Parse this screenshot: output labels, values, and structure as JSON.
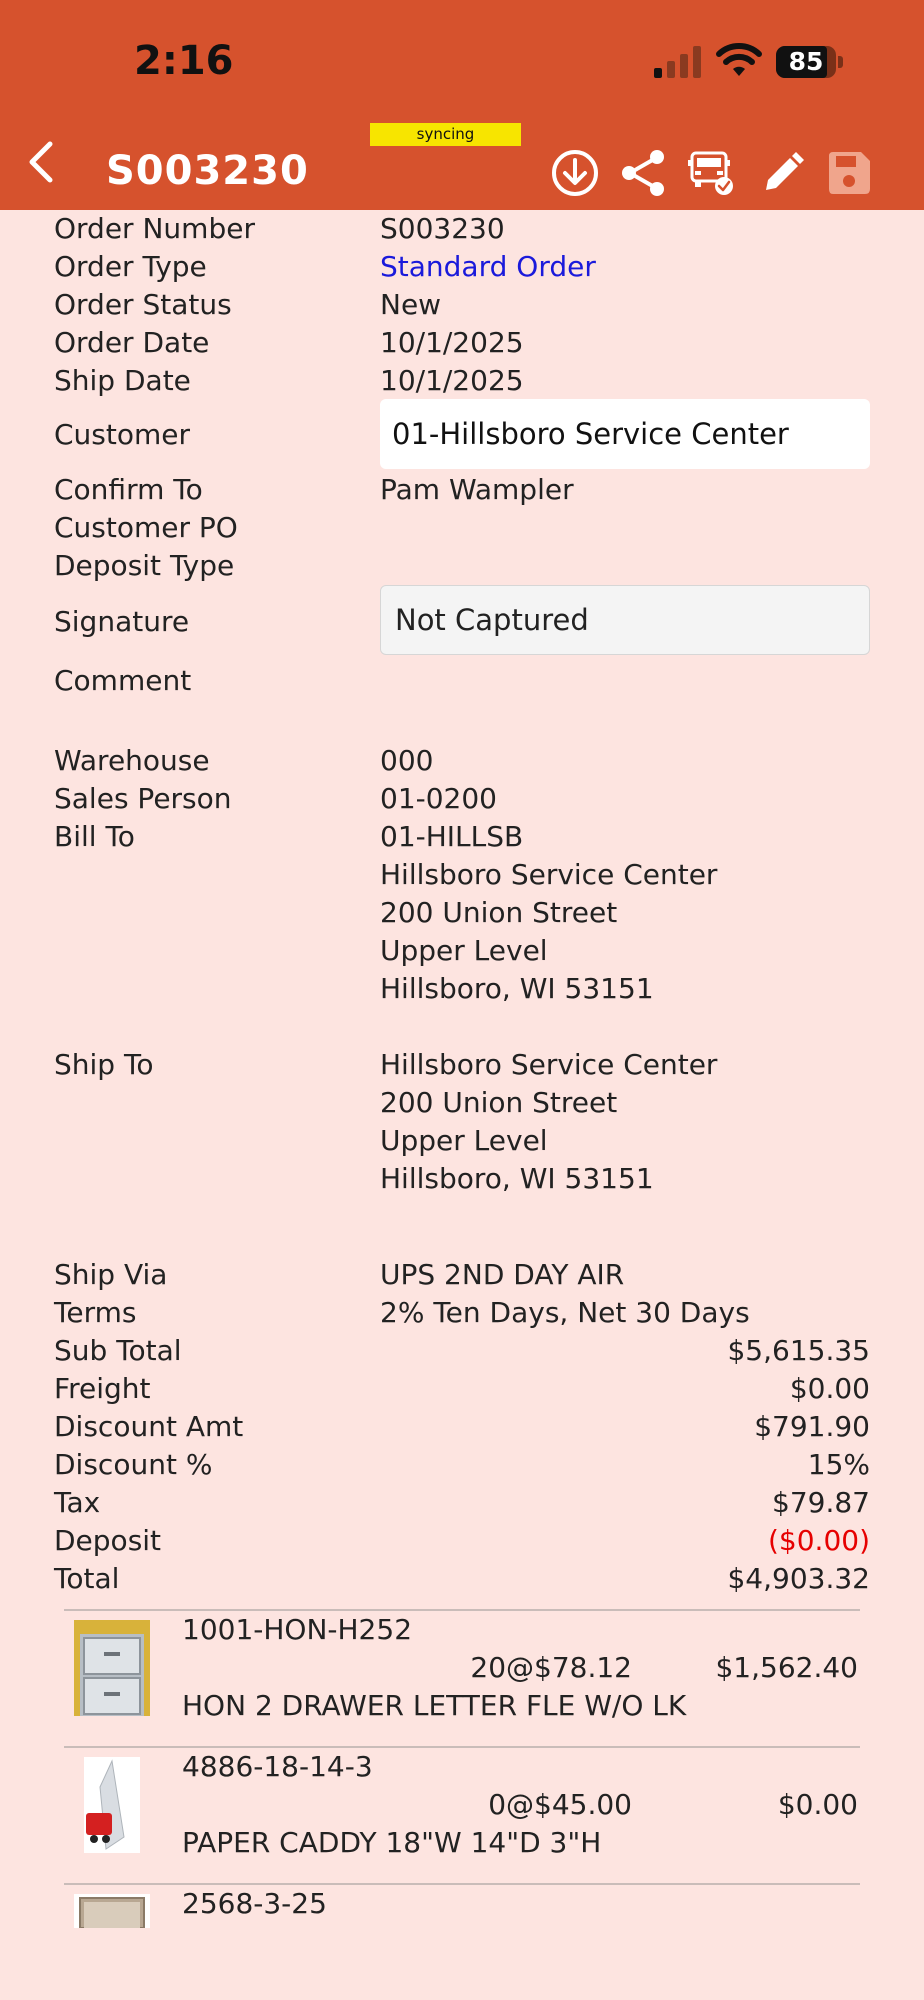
{
  "status_bar": {
    "time": "2:16",
    "battery": "85"
  },
  "nav": {
    "title": "S003230",
    "sync_label": "syncing"
  },
  "fields": {
    "order_number": {
      "label": "Order Number",
      "value": "S003230"
    },
    "order_type": {
      "label": "Order Type",
      "value": "Standard Order"
    },
    "order_status": {
      "label": "Order Status",
      "value": "New"
    },
    "order_date": {
      "label": "Order Date",
      "value": "10/1/2025"
    },
    "ship_date": {
      "label": "Ship Date",
      "value": "10/1/2025"
    },
    "customer": {
      "label": "Customer",
      "value": "01-Hillsboro Service Center"
    },
    "confirm_to": {
      "label": "Confirm To",
      "value": "Pam Wampler"
    },
    "customer_po": {
      "label": "Customer PO",
      "value": ""
    },
    "deposit_type": {
      "label": "Deposit Type",
      "value": ""
    },
    "signature": {
      "label": "Signature",
      "value": "Not Captured"
    },
    "comment": {
      "label": "Comment",
      "value": ""
    },
    "warehouse": {
      "label": "Warehouse",
      "value": "000"
    },
    "sales_person": {
      "label": "Sales Person",
      "value": "01-0200"
    },
    "bill_to": {
      "label": "Bill To",
      "lines": [
        "01-HILLSB",
        "Hillsboro Service Center",
        "200 Union Street",
        "Upper Level",
        "Hillsboro, WI 53151"
      ]
    },
    "ship_to": {
      "label": "Ship To",
      "lines": [
        "Hillsboro Service Center",
        "200 Union Street",
        "Upper Level",
        "Hillsboro, WI 53151"
      ]
    },
    "ship_via": {
      "label": "Ship Via",
      "value": "UPS 2ND DAY AIR"
    },
    "terms": {
      "label": "Terms",
      "value": "2% Ten Days, Net 30 Days"
    }
  },
  "totals": {
    "sub_total": {
      "label": "Sub Total",
      "value": "$5,615.35"
    },
    "freight": {
      "label": "Freight",
      "value": "$0.00"
    },
    "discount_amt": {
      "label": "Discount Amt",
      "value": "$791.90"
    },
    "discount_pct": {
      "label": "Discount %",
      "value": "15%"
    },
    "tax": {
      "label": "Tax",
      "value": "$79.87"
    },
    "deposit": {
      "label": "Deposit",
      "value": "($0.00)"
    },
    "total": {
      "label": "Total",
      "value": "$4,903.32"
    }
  },
  "colors": {
    "header": "#d6522d",
    "background": "#fde4e0",
    "link": "#1a1adb",
    "negative": "#e60000"
  },
  "line_items": [
    {
      "sku": "1001-HON-H252",
      "qty_price": "20@$78.12",
      "amount": "$1,562.40",
      "description": "HON 2 DRAWER LETTER FLE W/O LK"
    },
    {
      "sku": "4886-18-14-3",
      "qty_price": "0@$45.00",
      "amount": "$0.00",
      "description": "PAPER CADDY 18\"W 14\"D 3\"H"
    },
    {
      "sku": "2568-3-25",
      "qty_price": "",
      "amount": "",
      "description": ""
    }
  ]
}
